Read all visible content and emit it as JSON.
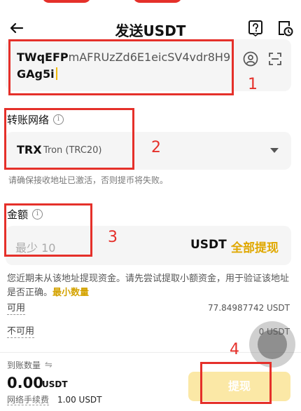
{
  "header": {
    "title": "发送USDT"
  },
  "address": {
    "bold_part": "TWqEFP",
    "rest_part": "mAFRUzZd6E1eicSV4vdr8H9",
    "bold_tail": "GAg5i"
  },
  "network": {
    "label": "转账网络",
    "code": "TRX",
    "name": "Tron (TRC20)",
    "warning": "请确保接收地址已激活，否则提币将失败。"
  },
  "amount": {
    "label": "金额",
    "placeholder": "最少 10",
    "unit": "USDT",
    "withdraw_all": "全部提现"
  },
  "notice": {
    "text": "您近期未从该地址提现资金。请先尝试提取小额资金，用于验证该地址是否正确。",
    "link": "最小数量"
  },
  "balances": {
    "available_label": "可用",
    "available_value": "77.84987742 USDT",
    "unavailable_label": "不可用",
    "unavailable_value": "0 USDT"
  },
  "footer": {
    "receive_label": "到账数量",
    "receive_value": "0.00",
    "receive_unit": "USDT",
    "fee_label": "网络手续费",
    "fee_value": "1.00 USDT",
    "submit_label": "提现"
  },
  "annotations": [
    "1",
    "2",
    "3",
    "4"
  ],
  "colors": {
    "accent": "#f0b90b",
    "annotation": "#e5302a",
    "button_disabled": "#fbe8a6"
  }
}
